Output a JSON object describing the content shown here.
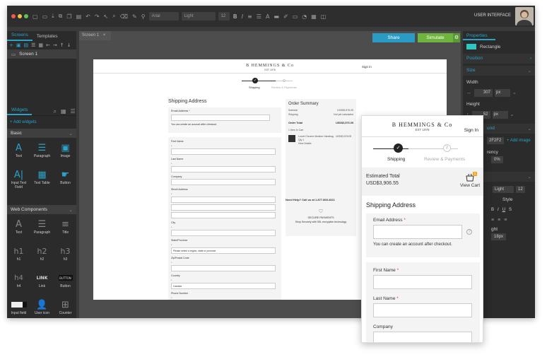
{
  "toolbar": {
    "font": "Arial",
    "weight": "Light",
    "size": "12",
    "user": "USER INTERFACE"
  },
  "left": {
    "tabs": [
      "Screens",
      "Templates"
    ],
    "screen": "Screen 1",
    "widgets_tab": "Widgets",
    "add_widgets": "+ Add widgets",
    "basic": "Basic",
    "web": "Web Components",
    "basic_items": [
      "Text",
      "Paragraph",
      "Image",
      "Input Text Field",
      "Text Table",
      "Button"
    ],
    "web_items": [
      "Text",
      "Paragraph",
      "Title",
      "h1",
      "h2",
      "h3",
      "h4",
      "Link",
      "Button",
      "Input field",
      "User icon",
      "Counter"
    ],
    "web_glyphs": {
      "h1": "h1",
      "h2": "h2",
      "h3": "h3",
      "h4": "h4",
      "link": "LINK",
      "button": "BUTTON"
    }
  },
  "center": {
    "tab": "Screen 1",
    "share": "Share",
    "simulate": "Simulate"
  },
  "canvas": {
    "brand": "B HEMMINGS & Co",
    "est": "EST 1978",
    "signin": "Sign in",
    "step1": "Shipping",
    "step2": "Review & Payments",
    "shipping_title": "Shipping Address",
    "email": "Email Address",
    "email_note": "You can create an account after checkout",
    "fields": [
      "First Name",
      "Last Name",
      "Company",
      "Street Address",
      "City",
      "State/Province",
      "Zip/Postal Code",
      "Country",
      "Phone Number"
    ],
    "state_ph": "Please select a region, state or province",
    "country_val": "Canada",
    "summary_title": "Order Summary",
    "subtotal": "Subtotal",
    "subtotal_v": "USD$3,576.05",
    "shipping": "Shipping",
    "shipping_v": "Not yet calculated",
    "order_total": "Order Total",
    "order_total_v": "USD$3,576.05",
    "items": "1 Item In Cart",
    "item_name": "Lorcel Chrome Medium Handbag",
    "qty": "Qty 1",
    "price": "USD$3,576.05",
    "view_details": "View Details",
    "help": "Need Help? Call us at 1.877.869.4321",
    "secure": "SECURE PAYMENTS",
    "secure_note": "Shop Securely with SSL encryption technology"
  },
  "right": {
    "properties": "Properties",
    "rect": "Rectangle",
    "position": "Position",
    "size": "Size",
    "width": "Width",
    "height": "Height",
    "w": "307",
    "h": "52",
    "unit": "px",
    "color": "2F2F2",
    "add_image": "+ Add image",
    "opacity": "0%",
    "weight": "Light",
    "fsize": "12",
    "style": "Style",
    "lh": "18",
    "round": "und",
    "rency": "rency",
    "ht": "ght",
    "px": "px"
  },
  "mobile": {
    "brand": "B HEMMINGS & Co",
    "est": "EST 1978",
    "signin": "Sign In",
    "step1": "Shipping",
    "step2": "Review & Payments",
    "step2_num": "2",
    "est_total": "Estimated Total",
    "est_value": "USD$3,906.55",
    "view_cart": "View Cart",
    "cart_count": "1",
    "title": "Shipping Address",
    "email": "Email Address",
    "email_note": "You can create an account after checkout.",
    "first": "First Name",
    "last": "Last Name",
    "company": "Company"
  }
}
